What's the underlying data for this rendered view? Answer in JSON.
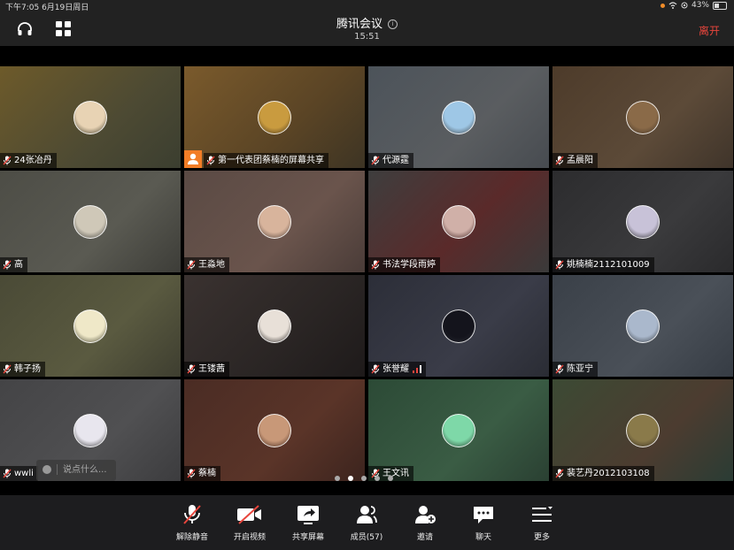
{
  "status": {
    "time": "下午7:05  6月19日周日",
    "battery": "43%",
    "battery_level": 0.43
  },
  "header": {
    "title": "腾讯会议",
    "info": "i",
    "clock": "15:51",
    "leave": "离开"
  },
  "participants": [
    {
      "name": "24张冶丹",
      "bg": "linear-gradient(135deg,#6d5a2a,#4d4a33 60%,#3b3e30)",
      "avatar": "#e8d3b4"
    },
    {
      "name": "第一代表团蔡楠的屏幕共享",
      "bg": "linear-gradient(135deg,#7a5a2c,#5a4425 60%,#3d3424)",
      "avatar": "#c99b3f",
      "host": true
    },
    {
      "name": "代源霆",
      "bg": "linear-gradient(135deg,#4c535a,#5a5d60 60%,#474b50)",
      "avatar": "#9ec7e6"
    },
    {
      "name": "孟晨阳",
      "bg": "linear-gradient(135deg,#4d3b2a,#5c4a38 60%,#3f342a)",
      "avatar": "#8a6a48"
    },
    {
      "name": "高",
      "bg": "linear-gradient(135deg,#4d4d46,#5a5a52 60%,#3d3d38)",
      "avatar": "#cfc8b8"
    },
    {
      "name": "王淼地",
      "bg": "linear-gradient(135deg,#5a4a44,#6a544c 60%,#4a3c38)",
      "avatar": "#d8b49c"
    },
    {
      "name": "书法学段雨婷",
      "bg": "linear-gradient(135deg,#3e3e3e,#5a2a2a 55%,#3a3a3a)",
      "avatar": "#d0b0a8"
    },
    {
      "name": "姚楠楠2112101009",
      "bg": "linear-gradient(135deg,#2c2c2e,#3a3a3c 60%,#2a2a2c)",
      "avatar": "#c8c2d8"
    },
    {
      "name": "韩子扬",
      "bg": "linear-gradient(135deg,#4a4a36,#5a5a40 60%,#3e3e30)",
      "avatar": "#efe8c8"
    },
    {
      "name": "王镂茜",
      "bg": "linear-gradient(135deg,#3a3230,#2a2524 60%,#1e1a1a)",
      "avatar": "#e8e0d8"
    },
    {
      "name": "张誉耀",
      "bg": "linear-gradient(135deg,#2c2e38,#3a3c48 60%,#2a2c34)",
      "avatar": "#14141c"
    },
    {
      "name": "陈亚宁",
      "bg": "linear-gradient(135deg,#3a4048,#4a5058 60%,#363c44)",
      "avatar": "#aab8cc"
    },
    {
      "name": "wwli",
      "bg": "linear-gradient(135deg,#444446,#505052 60%,#3c3c3e)",
      "avatar": "#e8e6ee"
    },
    {
      "name": "蔡楠",
      "bg": "linear-gradient(135deg,#4a2c24,#5a3428 60%,#3c241e)",
      "avatar": "#c89878"
    },
    {
      "name": "王文讯",
      "bg": "linear-gradient(135deg,#2c4a36,#3a5c44 60%,#2a4032)",
      "avatar": "#7ed8a8"
    },
    {
      "name": "裴艺丹2012103108",
      "bg": "linear-gradient(135deg,#3c4a34,#4c3c30 60%,#2a3c34)",
      "avatar": "#8a7a4a"
    }
  ],
  "chat": {
    "placeholder": "说点什么..."
  },
  "pager": {
    "count": 5,
    "active": 1
  },
  "toolbar": [
    {
      "label": "解除静音",
      "icon": "mic-muted-icon"
    },
    {
      "label": "开启视频",
      "icon": "video-off-icon"
    },
    {
      "label": "共享屏幕",
      "icon": "share-screen-icon"
    },
    {
      "label": "成员(57)",
      "icon": "members-icon"
    },
    {
      "label": "邀请",
      "icon": "invite-icon"
    },
    {
      "label": "聊天",
      "icon": "chat-icon"
    },
    {
      "label": "更多",
      "icon": "more-icon"
    }
  ]
}
